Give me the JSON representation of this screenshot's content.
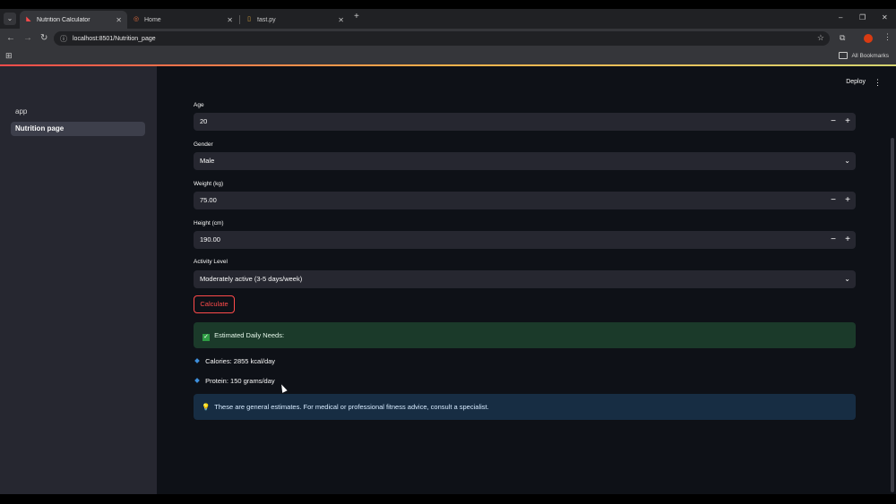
{
  "browser": {
    "tabs": [
      {
        "label": "Nutrition Calculator",
        "active": true
      },
      {
        "label": "Home",
        "active": false
      },
      {
        "label": "fast.py",
        "active": false
      }
    ],
    "new_tab": "+",
    "url": "localhost:8501/Nutrition_page",
    "bookmarks_label": "All Bookmarks",
    "window_controls": {
      "minimize": "–",
      "restore": "❐",
      "close": "✕"
    }
  },
  "sidebar": {
    "items": [
      {
        "label": "app",
        "selected": false
      },
      {
        "label": "Nutrition page",
        "selected": true
      }
    ]
  },
  "header": {
    "deploy_label": "Deploy"
  },
  "form": {
    "age": {
      "label": "Age",
      "value": "20"
    },
    "gender": {
      "label": "Gender",
      "value": "Male"
    },
    "weight": {
      "label": "Weight (kg)",
      "value": "75.00"
    },
    "height": {
      "label": "Height (cm)",
      "value": "190.00"
    },
    "activity": {
      "label": "Activity Level",
      "value": "Moderately active (3-5 days/week)"
    },
    "calculate_label": "Calculate"
  },
  "results": {
    "success_text": "Estimated Daily Needs:",
    "calories": "Calories: 2855 kcal/day",
    "protein": "Protein: 150 grams/day",
    "info_text": "These are general estimates. For medical or professional fitness advice, consult a specialist."
  },
  "colors": {
    "accent": "#ff4b4b",
    "success_bg": "#1b3a2a",
    "info_bg": "#172d43",
    "sidebar_bg": "#262730",
    "main_bg": "#0e1117"
  }
}
